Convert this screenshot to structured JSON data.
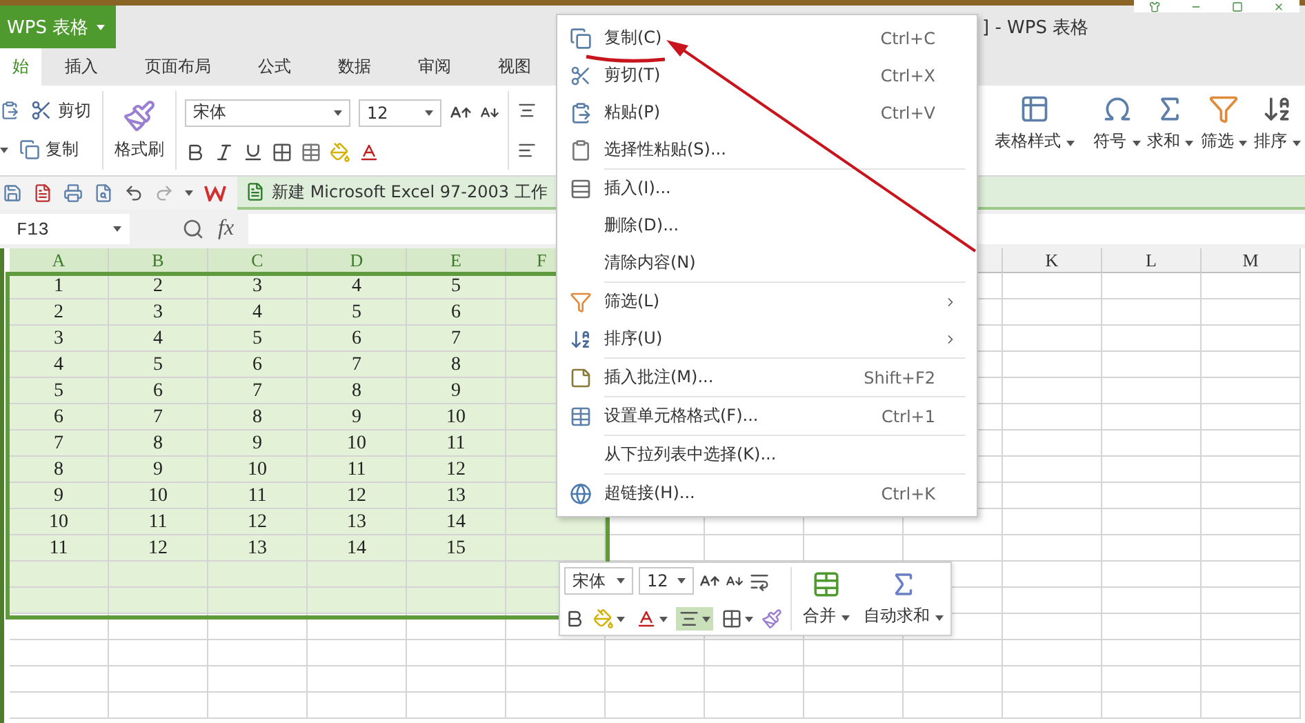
{
  "app_button": {
    "label": "WPS 表格"
  },
  "window": {
    "title": "] - WPS 表格"
  },
  "tabs": [
    {
      "label": "始",
      "selected": true
    },
    {
      "label": "插入",
      "selected": false
    },
    {
      "label": "页面布局",
      "selected": false
    },
    {
      "label": "公式",
      "selected": false
    },
    {
      "label": "数据",
      "selected": false
    },
    {
      "label": "审阅",
      "selected": false
    },
    {
      "label": "视图",
      "selected": false
    }
  ],
  "ribbon": {
    "cut": "剪切",
    "copy": "复制",
    "format_painter": "格式刷",
    "font": "宋体",
    "size": "12",
    "right_buttons": [
      {
        "label": "表格样式"
      },
      {
        "label": "符号"
      },
      {
        "label": "求和"
      },
      {
        "label": "筛选"
      },
      {
        "label": "排序"
      }
    ]
  },
  "doc_tab": {
    "label": "新建 Microsoft Excel 97-2003 工作"
  },
  "formula_bar": {
    "name_box": "F13",
    "fx": "fx"
  },
  "sheet": {
    "columns": [
      "A",
      "B",
      "C",
      "D",
      "E",
      "F"
    ],
    "columns_right": [
      "K",
      "L",
      "M"
    ],
    "rows": [
      {
        "cells": [
          "1",
          "2",
          "3",
          "4",
          "5"
        ],
        "selected": true
      },
      {
        "cells": [
          "2",
          "3",
          "4",
          "5",
          "6"
        ],
        "selected": true
      },
      {
        "cells": [
          "3",
          "4",
          "5",
          "6",
          "7"
        ],
        "selected": true
      },
      {
        "cells": [
          "4",
          "5",
          "6",
          "7",
          "8"
        ],
        "selected": true
      },
      {
        "cells": [
          "5",
          "6",
          "7",
          "8",
          "9"
        ],
        "selected": true
      },
      {
        "cells": [
          "6",
          "7",
          "8",
          "9",
          "10"
        ],
        "selected": true
      },
      {
        "cells": [
          "7",
          "8",
          "9",
          "10",
          "11"
        ],
        "selected": true
      },
      {
        "cells": [
          "8",
          "9",
          "10",
          "11",
          "12"
        ],
        "selected": true
      },
      {
        "cells": [
          "9",
          "10",
          "11",
          "12",
          "13"
        ],
        "selected": true
      },
      {
        "cells": [
          "10",
          "11",
          "12",
          "13",
          "14"
        ],
        "selected": true
      },
      {
        "cells": [
          "11",
          "12",
          "13",
          "14",
          "15"
        ],
        "selected": true
      },
      {
        "selected": true
      },
      {
        "selected": true
      }
    ]
  },
  "context_menu": {
    "groups": [
      [
        {
          "label": "复制(C)",
          "shortcut": "Ctrl+C",
          "submenu": false
        },
        {
          "label": "剪切(T)",
          "shortcut": "Ctrl+X",
          "submenu": false
        },
        {
          "label": "粘贴(P)",
          "shortcut": "Ctrl+V",
          "submenu": false
        },
        {
          "label": "选择性粘贴(S)...",
          "submenu": false
        }
      ],
      [
        {
          "label": "插入(I)...",
          "submenu": false
        },
        {
          "label": "删除(D)...",
          "submenu": false
        },
        {
          "label": "清除内容(N)",
          "submenu": false
        }
      ],
      [
        {
          "label": "筛选(L)",
          "submenu": true
        },
        {
          "label": "排序(U)",
          "submenu": true
        }
      ],
      [
        {
          "label": "插入批注(M)...",
          "shortcut": "Shift+F2",
          "submenu": false
        }
      ],
      [
        {
          "label": "设置单元格格式(F)...",
          "shortcut": "Ctrl+1",
          "submenu": false
        }
      ],
      [
        {
          "label": "从下拉列表中选择(K)...",
          "submenu": false
        }
      ],
      [
        {
          "label": "超链接(H)...",
          "shortcut": "Ctrl+K",
          "submenu": false
        }
      ]
    ]
  },
  "mini_toolbar": {
    "font": "宋体",
    "size": "12",
    "align_selected": true,
    "merge": "合并",
    "autosum": "自动求和"
  }
}
